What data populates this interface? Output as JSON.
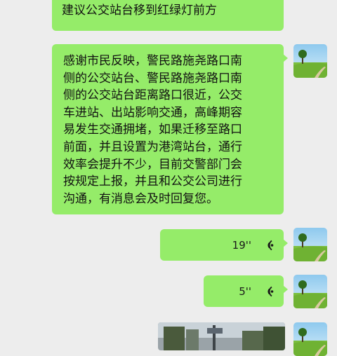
{
  "chat": {
    "messages": [
      {
        "type": "text",
        "text": "时目前事辆拥堵，目易造成拥堵，\n建议公交站台移到红绿灯前方"
      },
      {
        "type": "text",
        "text": "感谢市民反映，警民路施尧路口南\n侧的公交站台、警民路施尧路口南\n侧的公交站台距离路口很近，公交\n车进站、出站影响交通，高峰期容\n易发生交通拥堵，如果迁移至路口\n前面，并且设置为港湾站台，通行\n效率会提升不少，目前交警部门会\n按规定上报，并且和公交公司进行\n沟通，有消息会及时回复您。"
      },
      {
        "type": "voice",
        "duration": "19''",
        "icon": "voice-wave-icon"
      },
      {
        "type": "voice",
        "duration": "5''",
        "icon": "voice-wave-icon"
      },
      {
        "type": "image",
        "icon": "photo-thumbnail"
      }
    ]
  },
  "avatar": {
    "icon": "landscape-avatar-icon"
  },
  "colors": {
    "background": "#ededed",
    "bubble": "#95ec69",
    "text": "#111111"
  }
}
